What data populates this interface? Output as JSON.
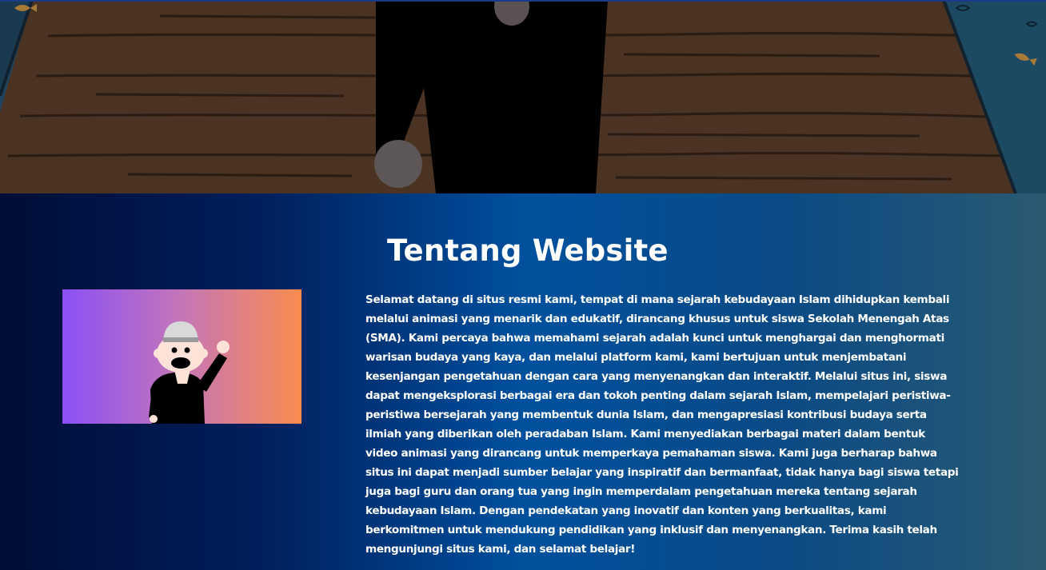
{
  "about": {
    "title": "Tentang Website",
    "paragraph": "Selamat datang di situs resmi kami, tempat di mana sejarah kebudayaan Islam dihidupkan kembali melalui animasi yang menarik dan edukatif, dirancang khusus untuk siswa Sekolah Menengah Atas (SMA). Kami percaya bahwa memahami sejarah adalah kunci untuk menghargai dan menghormati warisan budaya yang kaya, dan melalui platform kami, kami bertujuan untuk menjembatani kesenjangan pengetahuan dengan cara yang menyenangkan dan interaktif. Melalui situs ini, siswa dapat mengeksplorasi berbagai era dan tokoh penting dalam sejarah Islam, mempelajari peristiwa-peristiwa bersejarah yang membentuk dunia Islam, dan mengapresiasi kontribusi budaya serta ilmiah yang diberikan oleh peradaban Islam. Kami menyediakan berbagai materi dalam bentuk video animasi yang dirancang untuk memperkaya pemahaman siswa. Kami juga berharap bahwa situs ini dapat menjadi sumber belajar yang inspiratif dan bermanfaat, tidak hanya bagi siswa tetapi juga bagi guru dan orang tua yang ingin memperdalam pengetahuan mereka tentang sejarah kebudayaan Islam. Dengan pendekatan yang inovatif dan konten yang berkualitas, kami berkomitmen untuk mendukung pendidikan yang inklusif dan menyenangkan. Terima kasih telah mengunjungi situs kami, dan selamat belajar!"
  },
  "colors": {
    "section_gradient": [
      "#000d36",
      "#00509e",
      "#2b5a72"
    ],
    "image_gradient": [
      "#8b50f7",
      "#fb8c4e"
    ],
    "text": "#ffffff"
  },
  "icons": {
    "hero": "animated-character-on-wooden-pier-illustration",
    "about_image": "waving-character-with-kufi-cap-illustration"
  }
}
